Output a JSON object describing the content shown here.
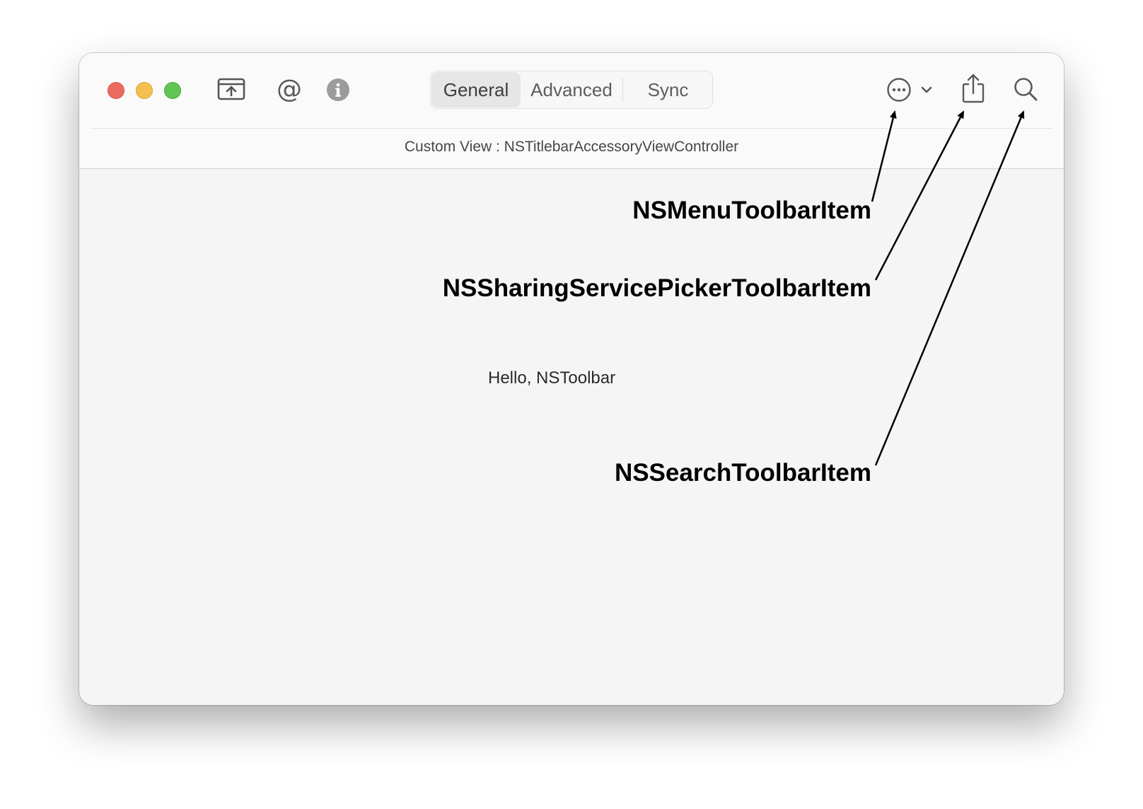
{
  "window": {
    "traffic_lights": {
      "close_color": "#ed6a5e",
      "minimize_color": "#f5bf4f",
      "zoom_color": "#61c554"
    },
    "toolbar": {
      "left_icons": [
        "export-tray-icon",
        "at-sign-icon",
        "info-icon"
      ],
      "at_glyph": "@",
      "segments": [
        "General",
        "Advanced",
        "Sync"
      ],
      "selected_segment": "General",
      "right_icons": [
        "ellipsis-circle-icon",
        "chevron-down-icon",
        "share-icon",
        "search-icon"
      ]
    },
    "accessory_text": "Custom View : NSTitlebarAccessoryViewController",
    "content_text": "Hello, NSToolbar"
  },
  "annotations": [
    {
      "label": "NSMenuToolbarItem"
    },
    {
      "label": "NSSharingServicePickerToolbarItem"
    },
    {
      "label": "NSSearchToolbarItem"
    }
  ]
}
